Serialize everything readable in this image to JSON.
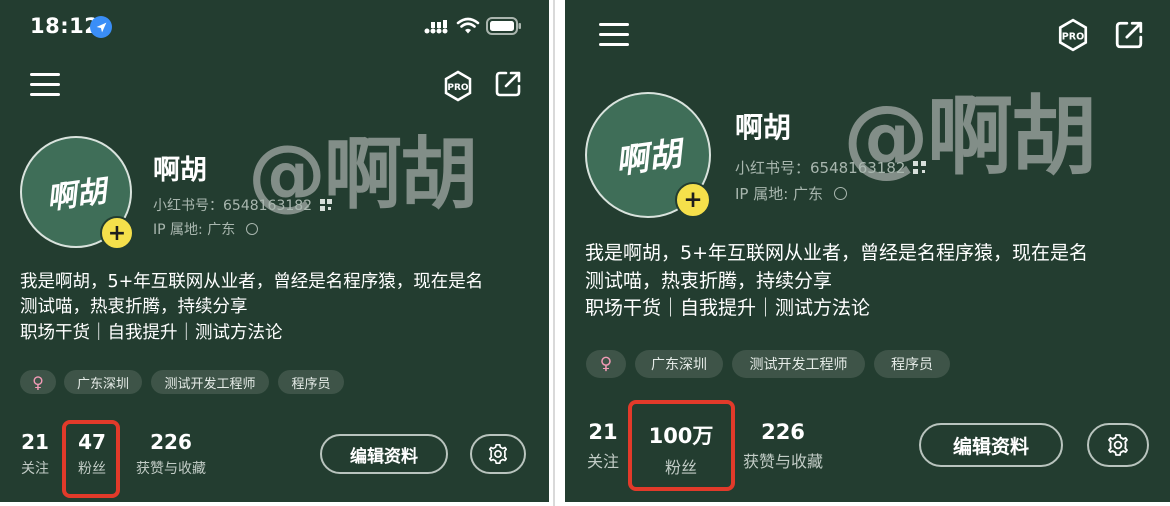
{
  "status_bar": {
    "time": "18:12"
  },
  "profile": {
    "nickname": "啊胡",
    "avatar_text": "啊胡",
    "red_id": "小红书号：6548163182",
    "ip_location": "IP 属地: 广东",
    "bio_lines": [
      "我是啊胡，5+年互联网从业者，曾经是名程序猿，现在是名",
      "测试喵，热衷折腾，持续分享",
      "职场干货｜自我提升｜测试方法论"
    ],
    "tags": [
      "广东深圳",
      "测试开发工程师",
      "程序员"
    ],
    "gender_symbol": "♀"
  },
  "watermark": "@啊胡",
  "pro_label": "PRO",
  "stats": {
    "following": {
      "value": "21",
      "label": "关注"
    },
    "followers_before": {
      "value": "47",
      "label": "粉丝"
    },
    "followers_after": {
      "value": "100万",
      "label": "粉丝"
    },
    "likes": {
      "value": "226",
      "label": "获赞与收藏"
    }
  },
  "actions": {
    "edit_label": "编辑资料"
  },
  "colors": {
    "background": "#233d30",
    "highlight": "#e23a2a",
    "plus": "#f5e04b"
  }
}
